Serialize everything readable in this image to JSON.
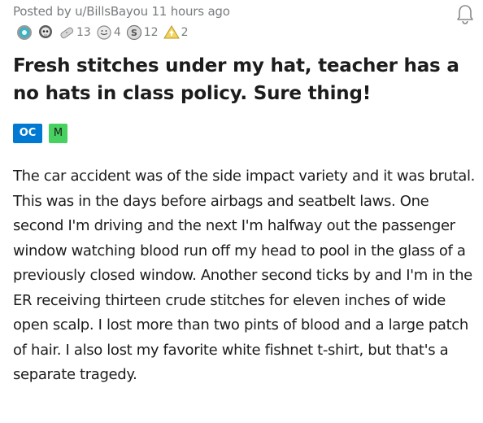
{
  "post": {
    "meta": "Posted by u/BillsBayou 11 hours ago",
    "title": "Fresh stitches under my hat, teacher has a no hats in class policy. Sure thing!",
    "body": "The car accident was of the side impact variety and it was brutal. This was in the days before airbags and seatbelt laws. One second I'm driving and the next I'm halfway out the passenger window watching blood run off my head to pool in the glass of a previously closed window. Another second ticks by and I'm in the ER receiving thirteen crude stitches for eleven inches of wide open scalp. I lost more than two pints of blood and a large patch of hair. I also lost my favorite white fishnet t-shirt, but that's a separate tragedy."
  },
  "awards": [
    {
      "icon": "gem-award-icon",
      "count": ""
    },
    {
      "icon": "skull-award-icon",
      "count": ""
    },
    {
      "icon": "bandage-award-icon",
      "count": "13"
    },
    {
      "icon": "hug-award-icon",
      "count": "4"
    },
    {
      "icon": "silver-award-icon",
      "count": "12"
    },
    {
      "icon": "helpful-award-icon",
      "count": "2"
    }
  ],
  "flairs": {
    "oc": "OC",
    "m": "M"
  },
  "colors": {
    "oc_flair": "#0079d3",
    "m_flair": "#46d160",
    "meta_text": "#787c7e"
  }
}
